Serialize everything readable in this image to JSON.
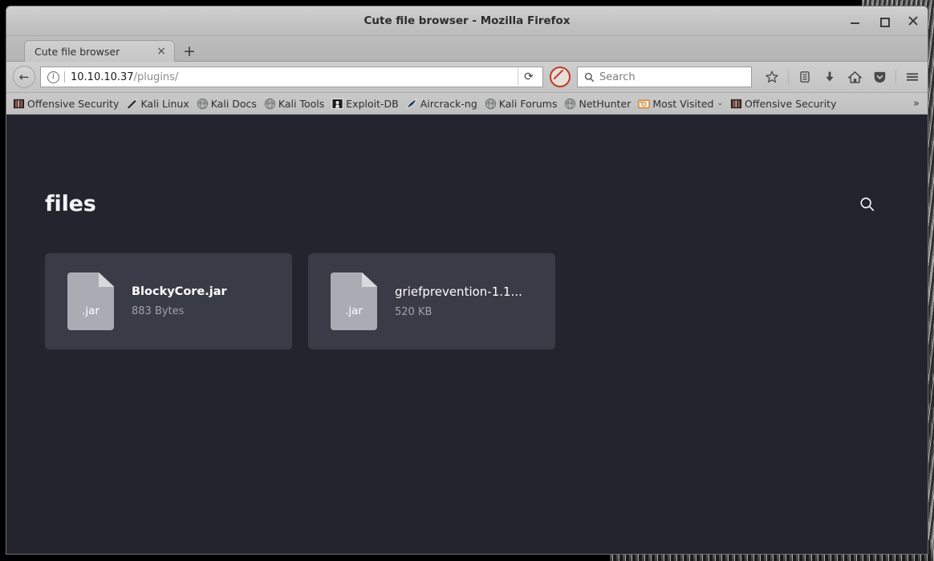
{
  "window": {
    "title": "Cute file browser - Mozilla Firefox",
    "minimize_label": "−",
    "maximize_label": "□",
    "close_label": "×"
  },
  "tabs": {
    "items": [
      {
        "label": "Cute file browser",
        "close_label": "×"
      }
    ],
    "new_tab_label": "+"
  },
  "toolbar": {
    "back_label": "←",
    "identity_label": "i",
    "url_host": "10.10.10.37",
    "url_path": "/plugins/",
    "reload_label": "⟳",
    "noscript_name": "noscript-blocked-icon",
    "search_placeholder": "Search",
    "icons": [
      {
        "name": "bookmark-star-icon",
        "glyph": "☆"
      },
      {
        "name": "library-icon",
        "glyph": "▤"
      },
      {
        "name": "downloads-icon",
        "glyph": "⬇"
      },
      {
        "name": "home-icon",
        "glyph": "⌂"
      },
      {
        "name": "pocket-icon",
        "glyph": "⛉"
      },
      {
        "name": "menu-hamburger-icon",
        "glyph": "☰"
      }
    ]
  },
  "bookmarks": {
    "items": [
      {
        "label": "Offensive Security",
        "icon": "offsec-icon",
        "chevron": ""
      },
      {
        "label": "Kali Linux",
        "icon": "kali-dragon-icon",
        "chevron": ""
      },
      {
        "label": "Kali Docs",
        "icon": "globe-icon",
        "chevron": ""
      },
      {
        "label": "Kali Tools",
        "icon": "globe-icon",
        "chevron": ""
      },
      {
        "label": "Exploit-DB",
        "icon": "exploitdb-icon",
        "chevron": ""
      },
      {
        "label": "Aircrack-ng",
        "icon": "aircrack-icon",
        "chevron": ""
      },
      {
        "label": "Kali Forums",
        "icon": "globe-icon",
        "chevron": ""
      },
      {
        "label": "NetHunter",
        "icon": "globe-icon",
        "chevron": ""
      },
      {
        "label": "Most Visited",
        "icon": "folder-icon",
        "chevron": "⌄"
      },
      {
        "label": "Offensive Security",
        "icon": "offsec-icon",
        "chevron": ""
      }
    ],
    "overflow_label": "»"
  },
  "page": {
    "title": "files",
    "search_icon_name": "search-icon",
    "background_color": "#23242e",
    "card_color": "#393b47",
    "files": [
      {
        "name": "BlockyCore.jar",
        "size": "883 Bytes",
        "ext": ".jar",
        "bold": true
      },
      {
        "name": "griefprevention-1.1...",
        "size": "520 KB",
        "ext": ".jar",
        "bold": false
      }
    ]
  }
}
